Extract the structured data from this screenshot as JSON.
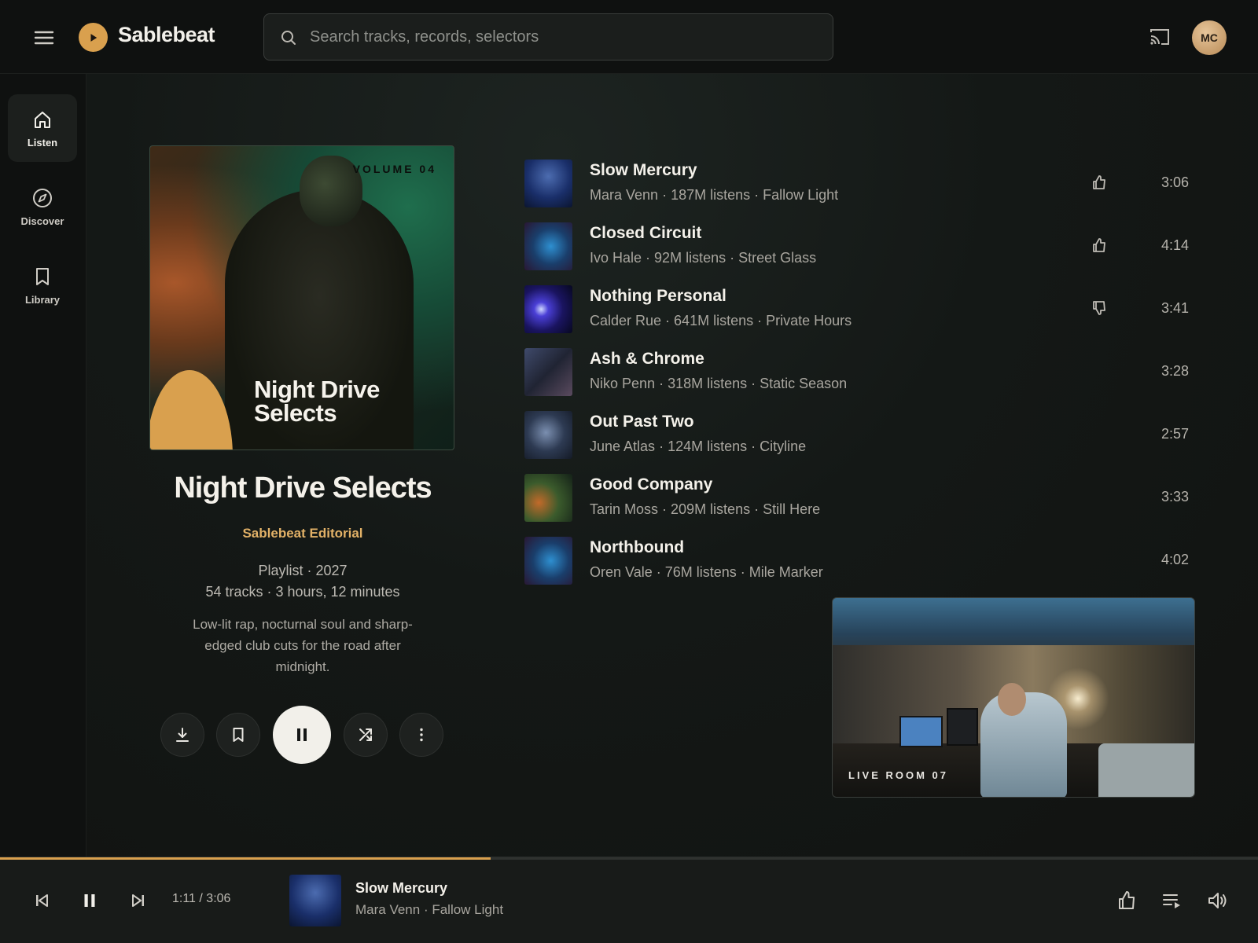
{
  "app": {
    "name": "Sablebeat",
    "accent_color": "#d9a04e"
  },
  "header": {
    "search_placeholder": "Search tracks, records, selectors",
    "user_initials": "MC",
    "icons": [
      "menu-icon",
      "play-icon",
      "search-icon",
      "cast-icon"
    ]
  },
  "sidebar": {
    "items": [
      {
        "label": "Listen",
        "icon": "home-icon",
        "active": true
      },
      {
        "label": "Discover",
        "icon": "compass-icon",
        "active": false
      },
      {
        "label": "Library",
        "icon": "bookmark-icon",
        "active": false
      }
    ]
  },
  "playlist": {
    "cover_volume": "VOLUME 04",
    "cover_title": "Night Drive Selects",
    "title": "Night Drive Selects",
    "curator": "Sablebeat Editorial",
    "type_year": "Playlist · 2027",
    "stats": "54 tracks · 3 hours, 12 minutes",
    "description": "Low-lit rap, nocturnal soul and sharp-edged club cuts for the road after midnight.",
    "controls": [
      "download-icon",
      "bookmark-icon",
      "pause-icon",
      "shuffle-icon",
      "more-vertical-icon"
    ]
  },
  "tracks": [
    {
      "title": "Slow Mercury",
      "artist": "Mara Venn",
      "listens": "187M listens",
      "album": "Fallow Light",
      "duration": "3:06",
      "feedback": "thumb-up-icon"
    },
    {
      "title": "Closed Circuit",
      "artist": "Ivo Hale",
      "listens": "92M listens",
      "album": "Street Glass",
      "duration": "4:14",
      "feedback": "thumb-up-icon"
    },
    {
      "title": "Nothing Personal",
      "artist": "Calder Rue",
      "listens": "641M listens",
      "album": "Private Hours",
      "duration": "3:41",
      "feedback": "thumb-down-icon"
    },
    {
      "title": "Ash & Chrome",
      "artist": "Niko Penn",
      "listens": "318M listens",
      "album": "Static Season",
      "duration": "3:28",
      "feedback": ""
    },
    {
      "title": "Out Past Two",
      "artist": "June Atlas",
      "listens": "124M listens",
      "album": "Cityline",
      "duration": "2:57",
      "feedback": ""
    },
    {
      "title": "Good Company",
      "artist": "Tarin Moss",
      "listens": "209M listens",
      "album": "Still Here",
      "duration": "3:33",
      "feedback": ""
    },
    {
      "title": "Northbound",
      "artist": "Oren Vale",
      "listens": "76M listens",
      "album": "Mile Marker",
      "duration": "4:02",
      "feedback": ""
    }
  ],
  "video": {
    "label": "LIVE ROOM 07"
  },
  "player": {
    "progress_percent": 39,
    "time": "1:11 / 3:06",
    "title": "Slow Mercury",
    "subtitle": "Mara Venn · Fallow Light",
    "icons": [
      "skip-previous-icon",
      "pause-icon",
      "skip-next-icon",
      "thumb-up-icon",
      "queue-icon",
      "volume-icon"
    ]
  }
}
